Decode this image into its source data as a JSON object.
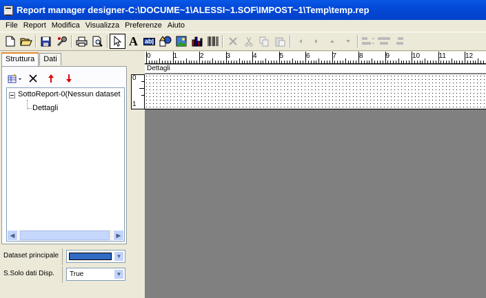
{
  "window": {
    "title": "Report manager designer-C:\\DOCUME~1\\ALESSI~1.SOF\\IMPOST~1\\Temp\\temp.rep"
  },
  "menu": [
    "File",
    "Report",
    "Modifica",
    "Visualizza",
    "Preferenze",
    "Aiuto"
  ],
  "toolbar": {
    "icons": [
      "new-document-icon",
      "open-folder-icon",
      "save-icon",
      "wrench-icon",
      "print-icon",
      "print-preview-icon",
      "pointer-icon",
      "text-icon",
      "field-icon",
      "shapes-icon",
      "image-icon",
      "chart-icon",
      "barcode-icon",
      "cut-icon",
      "scissors-icon",
      "copy-icon",
      "paste-icon",
      "arrow-left-icon",
      "arrow-right-icon",
      "arrow-up-icon",
      "arrow-down-icon",
      "align-left-icon",
      "align-center-icon",
      "align-right-icon"
    ],
    "text_tool_glyph": "A",
    "field_tool_glyph": "ab|"
  },
  "left_panel": {
    "tabs": [
      "Struttura",
      "Dati"
    ],
    "active_tab": "Struttura",
    "tree": {
      "root": "SottoReport-0(Nessun dataset",
      "child": "Dettagli"
    }
  },
  "properties": [
    {
      "label": "Dataset principale",
      "value": "",
      "selected_color": "#316ac5"
    },
    {
      "label": "S.Solo dati Disp.",
      "value": "True"
    }
  ],
  "designer": {
    "ruler_numbers": [
      "0",
      "1",
      "2",
      "3",
      "4",
      "5",
      "6",
      "7",
      "8",
      "9",
      "10",
      "11",
      "12"
    ],
    "vertical_ruler_numbers": [
      "0",
      "1"
    ],
    "band_label": "Dettagli"
  },
  "colors": {
    "titlebar": "#0349d8",
    "workspace": "#808080",
    "selection": "#316ac5"
  }
}
